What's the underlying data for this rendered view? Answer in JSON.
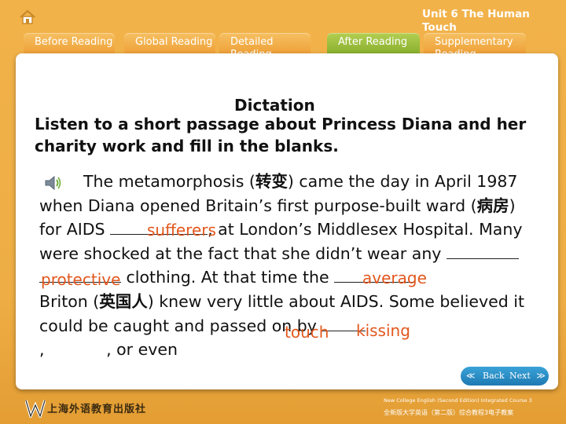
{
  "header": {
    "unit_title": "Unit 6 The Human Touch",
    "tabs": [
      {
        "label": "Before Reading"
      },
      {
        "label": "Global Reading"
      },
      {
        "label": "Detailed Reading"
      },
      {
        "label": "After Reading"
      },
      {
        "label": "Supplementary Reading"
      }
    ],
    "active_tab": "After Reading"
  },
  "main": {
    "heading": "Dictation",
    "instruction": "Listen to a short passage about Princess Diana and her charity work and fill in the blanks.",
    "passage": {
      "s1": "The metamorphosis (",
      "s1_cn": "转变",
      "s2": ") came the day in April 1987 when Diana opened Britain’s first purpose-built ward (",
      "s2_cn": "病房",
      "s3": ") for AIDS",
      "s4": ", at London’s Middlesex Hospital.  Many were shocked at the fact that she didn’t wear any",
      "s5": "clothing. At that time the",
      "s6": "Briton (",
      "s6_cn": "英国人",
      "s7": ") knew very little about AIDS. Some believed it could be caught and passed on by",
      "s8": ",",
      "s9": ", or even"
    },
    "answers": {
      "sufferers": "sufferers",
      "protective": "protective",
      "average": "average",
      "touch": "touch",
      "kissing": "kissing"
    }
  },
  "nav": {
    "back": "Back",
    "next": "Next"
  },
  "footer": {
    "publisher": "上海外语教育出版社",
    "course_en": "New College English (Second Edition) Integrated Course 3",
    "course_cn": "全新版大学英语（第二版）综合教程3电子教案"
  },
  "colors": {
    "answer": "#e2571d",
    "active_tab": "#9cbf3a",
    "tab": "#f0a53c"
  }
}
